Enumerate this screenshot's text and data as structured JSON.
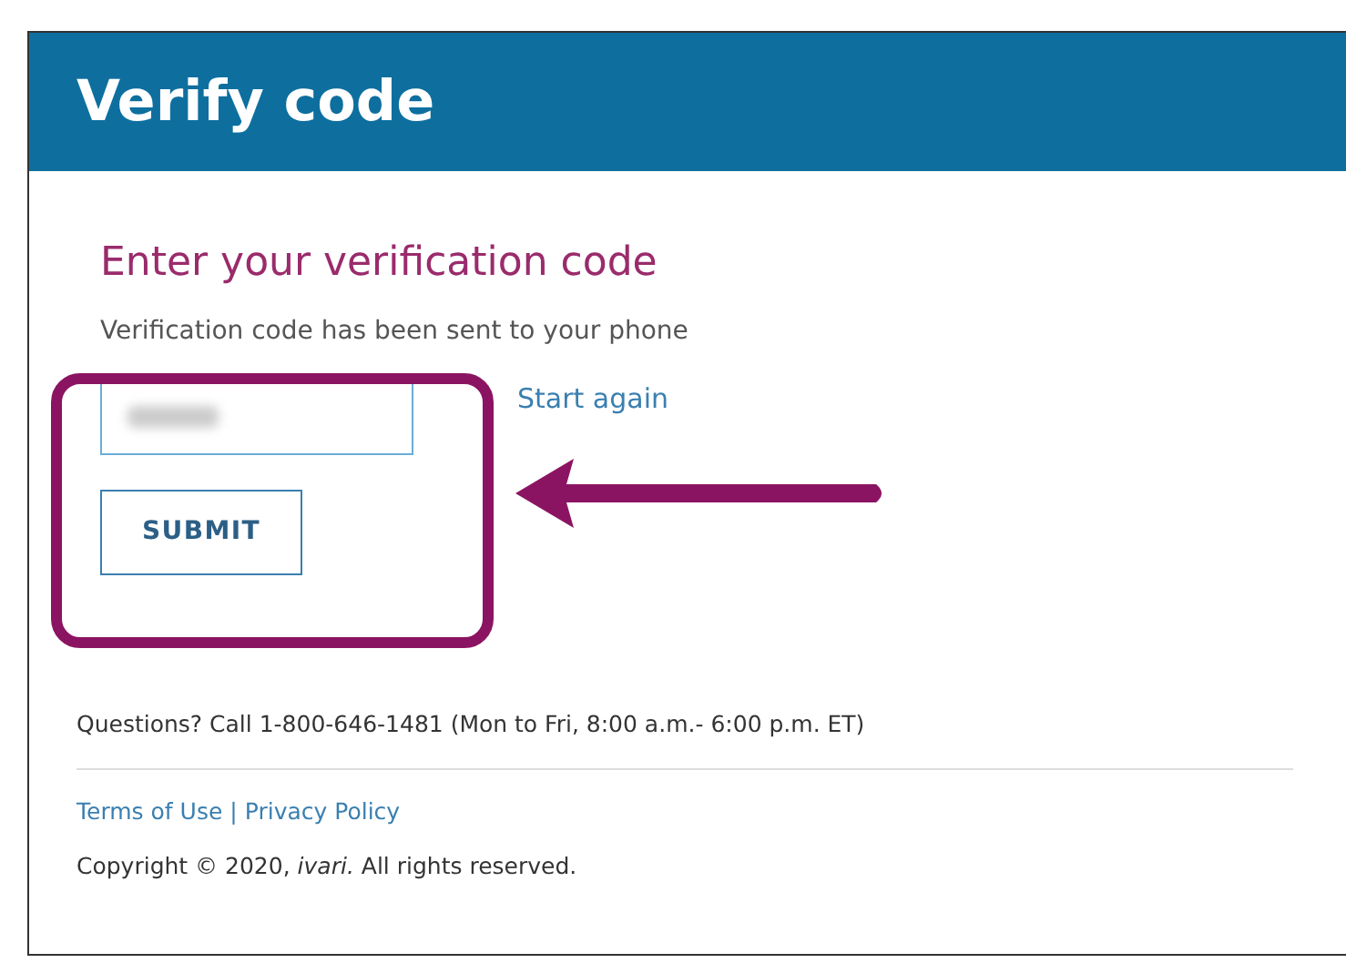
{
  "header": {
    "title": "Verify code"
  },
  "form": {
    "heading": "Enter your verification code",
    "message": "Verification code has been sent to your phone",
    "code_field": {
      "obscured": true
    },
    "start_again_link": "Start again",
    "submit_button": "SUBMIT"
  },
  "footer": {
    "questions": "Questions? Call 1-800-646-1481 (Mon to Fri, 8:00 a.m.- 6:00 p.m. ET)",
    "links": [
      "Terms of Use",
      "Privacy Policy"
    ],
    "separator": "|",
    "copyright": "Copyright © 2020, *ivari.* All rights reserved."
  }
}
